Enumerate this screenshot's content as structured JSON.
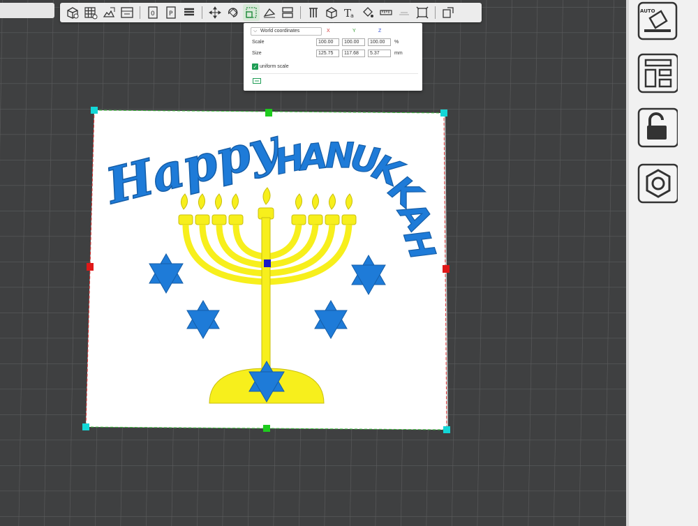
{
  "toolbar": {
    "icons": [
      "add-cube-icon",
      "grid-icon",
      "image-import-icon",
      "layout-icon",
      "page-0-icon",
      "page-p-icon",
      "stack-icon",
      "move-icon",
      "rotate-icon",
      "scale-icon",
      "cut-icon",
      "split-icon",
      "support-icon",
      "cube-icon",
      "text-icon",
      "paint-icon",
      "measure-icon",
      "assembly-icon",
      "emboss-icon",
      "fit-icon"
    ]
  },
  "scale_panel": {
    "coordinate_mode": "World coordinates",
    "axes": {
      "x": "X",
      "y": "Y",
      "z": "Z"
    },
    "axis_colors": {
      "x": "#d63a3a",
      "y": "#2f9a2f",
      "z": "#2f4fd6"
    },
    "rows": [
      {
        "label": "Scale",
        "x": "100.00",
        "y": "100.00",
        "z": "100.00",
        "unit": "%"
      },
      {
        "label": "Size",
        "x": "125.75",
        "y": "117.68",
        "z": "5.37",
        "unit": "mm"
      }
    ],
    "uniform_scale_label": "uniform scale",
    "uniform_scale_checked": true
  },
  "side_panel": {
    "buttons": [
      "auto-orient-icon",
      "arrange-layout-icon",
      "lock-icon",
      "nut-settings-icon"
    ],
    "auto_label": "AUTO"
  },
  "model": {
    "text_happy": "Happy",
    "text_hanukkah": "HANUKKAH",
    "colors": {
      "text": "#1e7bd8",
      "menorah": "#f7ef1c",
      "stars": "#1e7bd8",
      "plate": "#ffffff"
    }
  },
  "colors": {
    "bed": "#3f4041",
    "grid_line": "#5a5b5c",
    "selection_dash_side": "#e03030",
    "selection_dash_topbottom": "#3fc33f",
    "corner_handle": "#13d7d7",
    "mid_handle_red": "#e01818",
    "mid_handle_green": "#1ecc1e",
    "center_handle": "#1a1ac8"
  }
}
